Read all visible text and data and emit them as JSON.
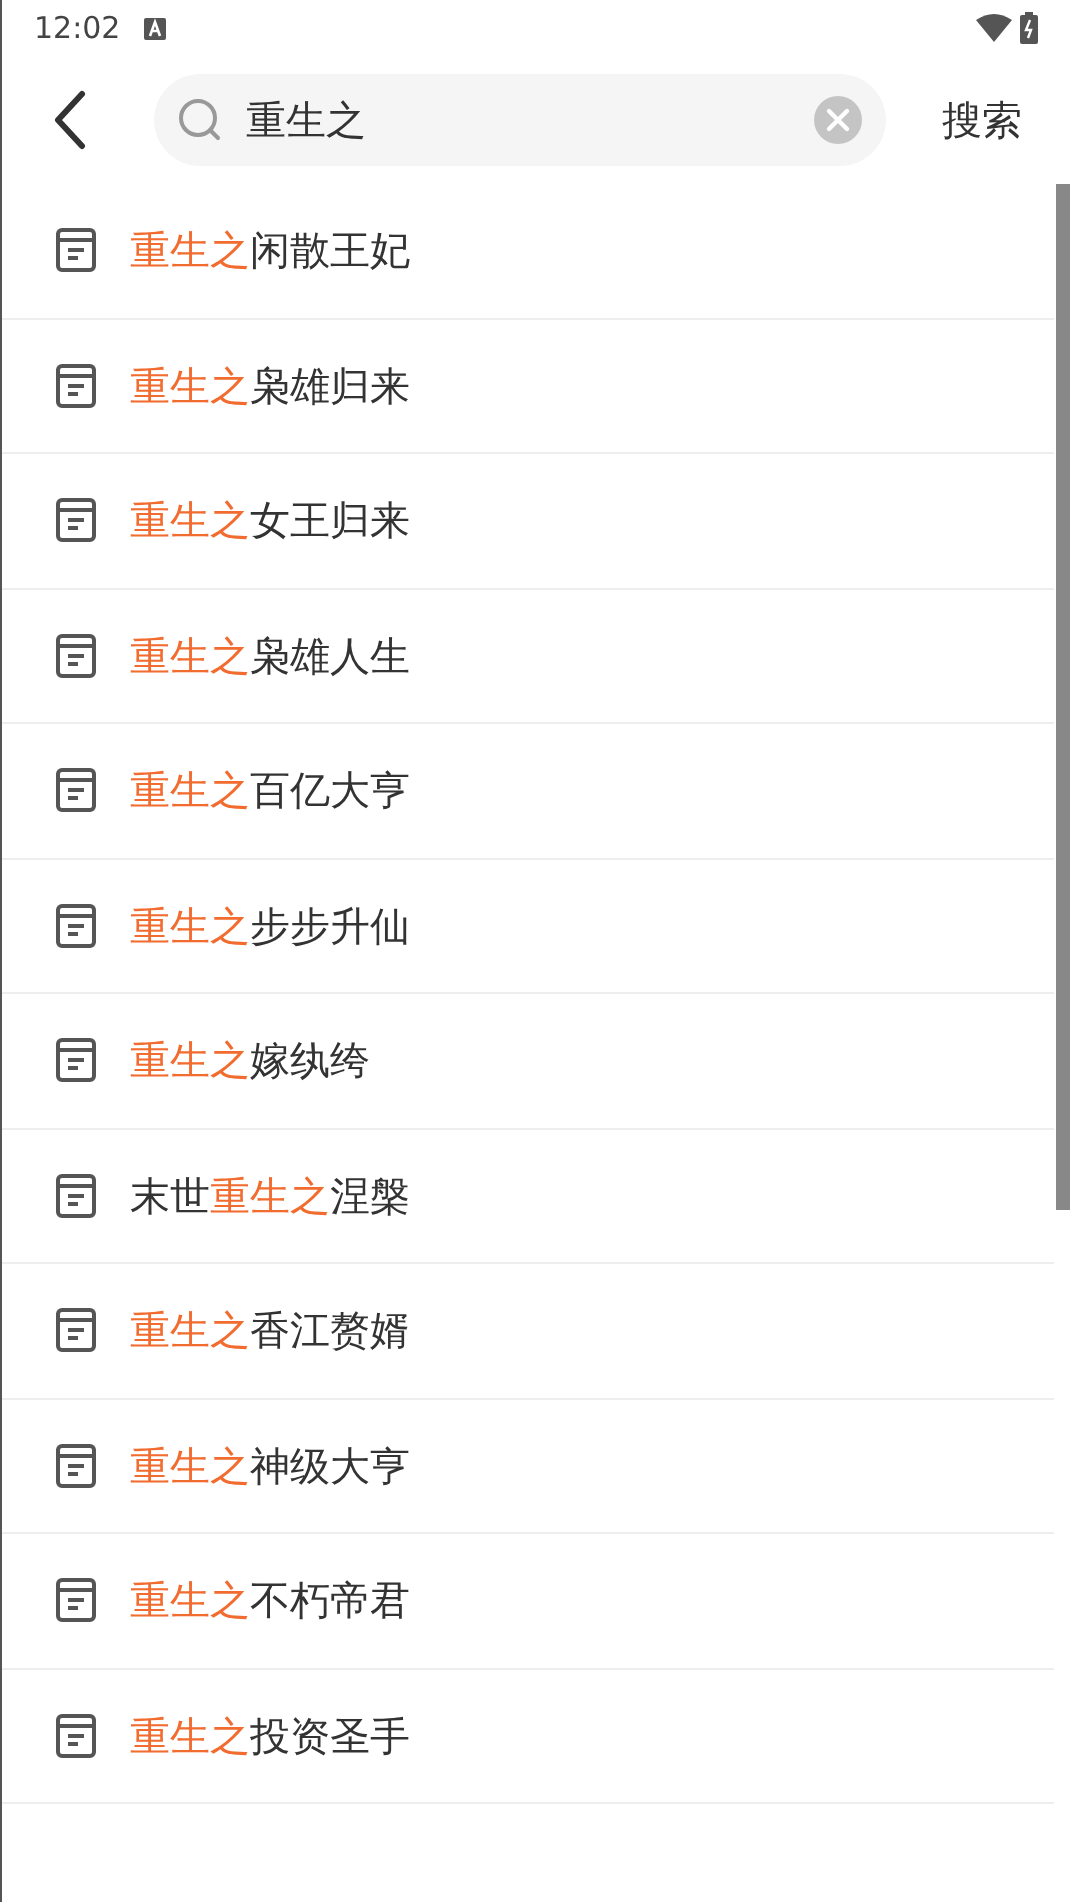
{
  "status_bar": {
    "time": "12:02"
  },
  "search": {
    "value": "重生之",
    "action": "搜索"
  },
  "results": [
    {
      "parts": [
        {
          "text": "重生之",
          "highlight": true
        },
        {
          "text": "闲散王妃",
          "highlight": false
        }
      ]
    },
    {
      "parts": [
        {
          "text": "重生之",
          "highlight": true
        },
        {
          "text": "枭雄归来",
          "highlight": false
        }
      ]
    },
    {
      "parts": [
        {
          "text": "重生之",
          "highlight": true
        },
        {
          "text": "女王归来",
          "highlight": false
        }
      ]
    },
    {
      "parts": [
        {
          "text": "重生之",
          "highlight": true
        },
        {
          "text": "枭雄人生",
          "highlight": false
        }
      ]
    },
    {
      "parts": [
        {
          "text": "重生之",
          "highlight": true
        },
        {
          "text": "百亿大亨",
          "highlight": false
        }
      ]
    },
    {
      "parts": [
        {
          "text": "重生之",
          "highlight": true
        },
        {
          "text": "步步升仙",
          "highlight": false
        }
      ]
    },
    {
      "parts": [
        {
          "text": "重生之",
          "highlight": true
        },
        {
          "text": "嫁纨绔",
          "highlight": false
        }
      ]
    },
    {
      "parts": [
        {
          "text": "末世",
          "highlight": false
        },
        {
          "text": "重生之",
          "highlight": true
        },
        {
          "text": "涅槃",
          "highlight": false
        }
      ]
    },
    {
      "parts": [
        {
          "text": "重生之",
          "highlight": true
        },
        {
          "text": "香江赘婿",
          "highlight": false
        }
      ]
    },
    {
      "parts": [
        {
          "text": "重生之",
          "highlight": true
        },
        {
          "text": "神级大亨",
          "highlight": false
        }
      ]
    },
    {
      "parts": [
        {
          "text": "重生之",
          "highlight": true
        },
        {
          "text": "不朽帝君",
          "highlight": false
        }
      ]
    },
    {
      "parts": [
        {
          "text": "重生之",
          "highlight": true
        },
        {
          "text": "投资圣手",
          "highlight": false
        }
      ]
    }
  ]
}
